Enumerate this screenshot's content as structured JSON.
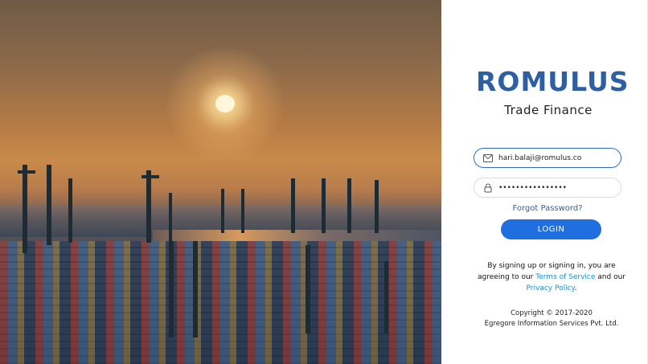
{
  "brand": {
    "logo_text": "ROMULUS",
    "subtitle": "Trade Finance",
    "color": "#2f5fa3"
  },
  "form": {
    "email_value": "hari.balaji@romulus.co",
    "password_value": "••••••••••••••••",
    "email_icon": "mail-icon",
    "password_icon": "lock-icon",
    "forgot_label": "Forgot Password?",
    "login_label": "LOGIN",
    "accent": "#1f6fe0"
  },
  "terms": {
    "prefix": "By signing up or signing in, you are agreeing to our",
    "terms_link": "Terms of Service",
    "middle": "and our",
    "privacy_link": "Privacy Policy",
    "suffix": "."
  },
  "footer": {
    "copyright": "Copyright © 2017-2020",
    "company": "Egregore Information Services Pvt. Ltd."
  },
  "hero": {
    "description_icon": "port-sunset-image"
  }
}
